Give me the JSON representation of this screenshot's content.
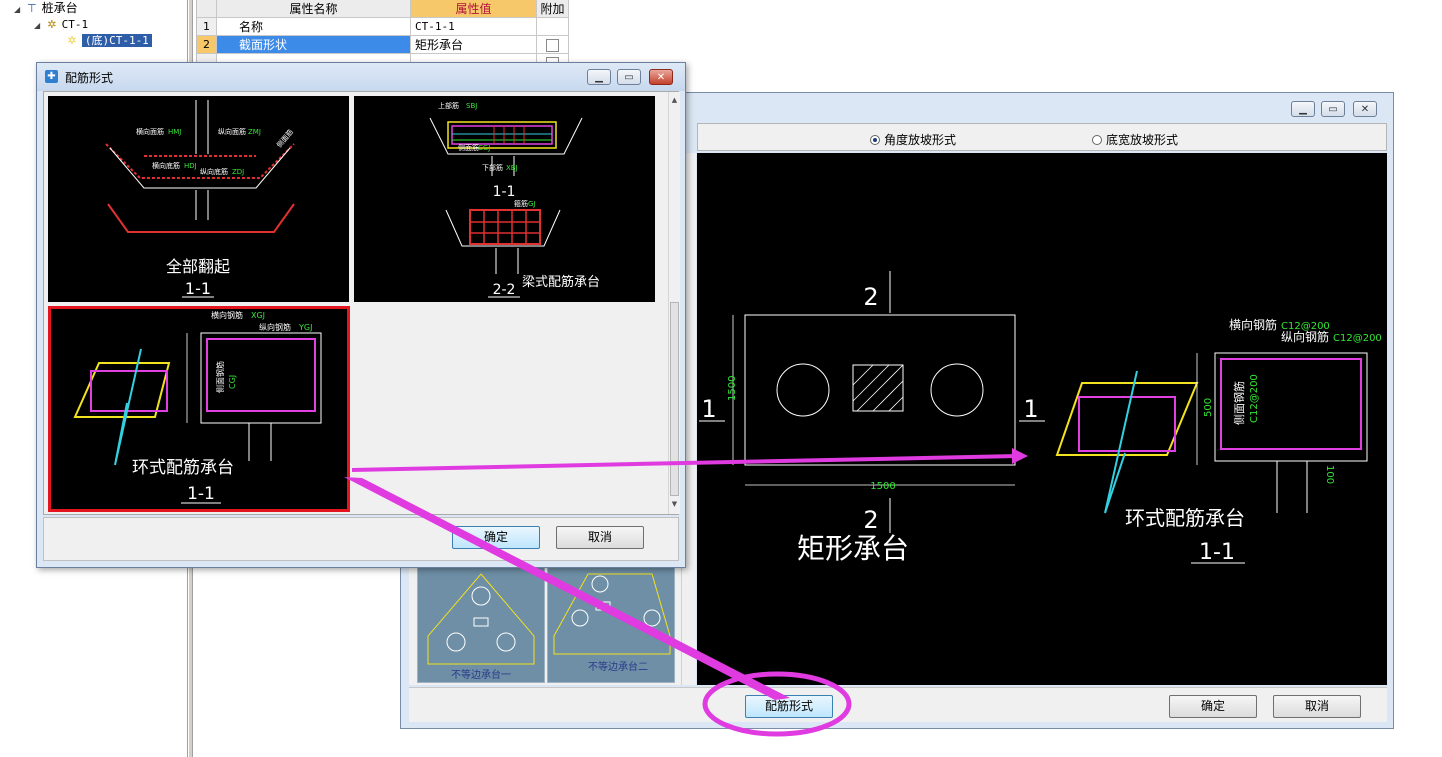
{
  "tree": {
    "items": [
      {
        "label": "桩承台",
        "icon": "pile-cap-icon"
      },
      {
        "label": "CT-1",
        "icon": "component-gear-icon"
      },
      {
        "label": "(底)CT-1-1",
        "icon": "component-gear-icon",
        "selected": true
      }
    ]
  },
  "property_grid": {
    "headers": {
      "name": "属性名称",
      "value": "属性值",
      "extra": "附加"
    },
    "rows": [
      {
        "num": "1",
        "name": "名称",
        "value": "CT-1-1"
      },
      {
        "num": "2",
        "name": "截面形状",
        "value": "矩形承台"
      }
    ]
  },
  "back_window": {
    "radio_angle": "角度放坡形式",
    "radio_width": "底宽放坡形式",
    "canvas": {
      "section_marks": [
        "2",
        "2",
        "1",
        "1"
      ],
      "dim_height": "1500",
      "dim_width": "1500",
      "title": "矩形承台",
      "label_horizontal": "横向钢筋",
      "label_horizontal_value": "C12@200",
      "label_vertical": "纵向钢筋",
      "label_vertical_value": "C12@200",
      "label_side": "侧面钢筋",
      "label_side_value": "C12@200",
      "dim_500": "500",
      "dim_100": "100",
      "ring_title": "环式配筋承台",
      "ring_section": "1-1"
    },
    "thumbnails": {
      "left_caption": "不等边承台一",
      "right_caption": "不等边承台二"
    },
    "rebar_button": "配筋形式",
    "ok_button": "确定",
    "cancel_button": "取消"
  },
  "front_dialog": {
    "title": "配筋形式",
    "options": [
      {
        "caption": "全部翻起",
        "section": "1-1",
        "tags": [
          "横向面筋",
          "HMJ",
          "纵向面筋",
          "ZMJ",
          "横向底筋",
          "HDJ",
          "纵向底筋",
          "ZDJ",
          "侧面筋"
        ]
      },
      {
        "caption": "梁式配筋承台",
        "section_top": "1-1",
        "section_bottom": "2-2",
        "tags": [
          "上部筋",
          "SBJ",
          "侧面筋",
          "CGJ",
          "箍筋",
          "GJ",
          "下部筋",
          "XBJ"
        ]
      },
      {
        "caption": "环式配筋承台",
        "section": "1-1",
        "tags": [
          "横向钢筋",
          "XGJ",
          "纵向钢筋",
          "YGJ",
          "侧面钢筋",
          "CGJ"
        ],
        "selected": true
      }
    ],
    "ok_button": "确定",
    "cancel_button": "取消"
  },
  "colors": {
    "highlight": "#e03be0",
    "selection_border": "#e3161f",
    "rebar_magenta": "#e040e0",
    "rebar_green": "#39e639",
    "yellow": "#f2e21f",
    "cyan": "#33d0e0"
  }
}
